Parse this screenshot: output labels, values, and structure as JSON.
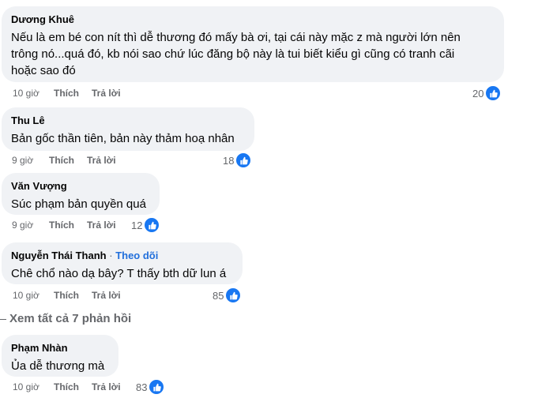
{
  "comments": [
    {
      "author": "Dương Khuê",
      "text_lines": [
        "Nếu là em bé con nít thì dễ thương đó mấy bà ơi, tại cái này mặc z mà người lớn nên",
        "trông nó...quá đó, kb nói sao chứ lúc đăng bộ này là tui biết kiểu gì cũng có tranh cãi",
        "hoặc sao đó"
      ],
      "time": "10 giờ",
      "like_label": "Thích",
      "reply_label": "Trả lời",
      "reactions": "20"
    },
    {
      "author": "Thu Lê",
      "text_lines": [
        "Bản gốc thần tiên, bản này thảm hoạ nhân"
      ],
      "time": "9 giờ",
      "like_label": "Thích",
      "reply_label": "Trả lời",
      "reactions": "18"
    },
    {
      "author": "Văn Vượng",
      "text_lines": [
        "Súc phạm bản quyền quá"
      ],
      "time": "9 giờ",
      "like_label": "Thích",
      "reply_label": "Trả lời",
      "reactions": "12"
    },
    {
      "author": "Nguyễn Thái Thanh",
      "follow": "Theo dõi",
      "text_lines": [
        "Chê chổ nào dạ bây? T thấy bth dữ lun á"
      ],
      "time": "10 giờ",
      "like_label": "Thích",
      "reply_label": "Trả lời",
      "reactions": "85"
    },
    {
      "author": "Phạm Nhàn",
      "text_lines": [
        "Ủa dễ thương mà"
      ],
      "time": "10 giờ",
      "like_label": "Thích",
      "reply_label": "Trả lời",
      "reactions": "83"
    }
  ],
  "view_more": "Xem tất cả 7 phản hồi",
  "colors": {
    "bubble": "#f0f2f5",
    "secondary_text": "#65676b",
    "like_blue": "#1877f2",
    "follow_blue": "#216fdb"
  },
  "icons": {
    "reaction": "like-thumb-icon"
  }
}
